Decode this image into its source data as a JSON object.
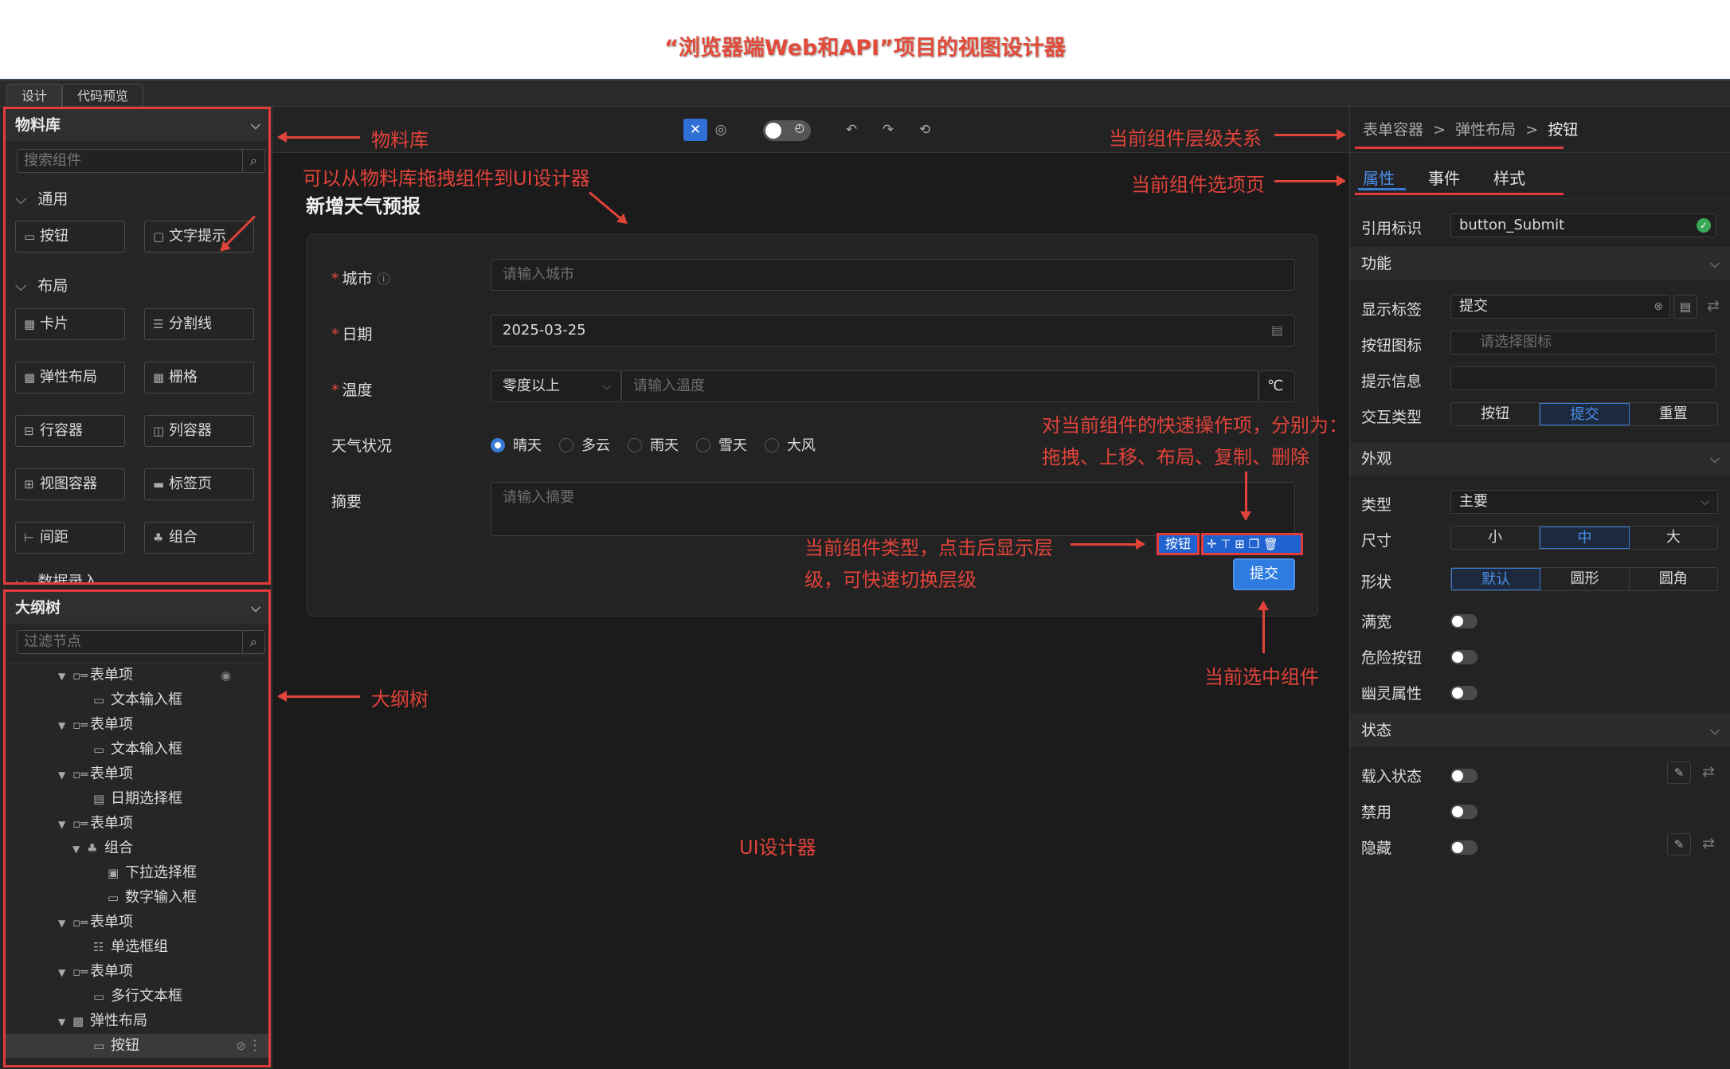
{
  "page_title": "“浏览器端Web和API”项目的视图设计器",
  "mode_tabs": [
    "设计",
    "代码预览"
  ],
  "material": {
    "title": "物料库",
    "search_placeholder": "搜索组件",
    "group_common": "通用",
    "group_layout": "布局",
    "group_input": "数据录入",
    "components": {
      "button": "按钮",
      "tooltip": "文字提示",
      "card": "卡片",
      "divider": "分割线",
      "flex": "弹性布局",
      "grid": "栅格",
      "row": "行容器",
      "col": "列容器",
      "view": "视图容器",
      "tabs": "标签页",
      "space": "间距",
      "combo": "组合"
    }
  },
  "outline": {
    "title": "大纲树",
    "search_placeholder": "过滤节点",
    "nodes": [
      {
        "label": "表单项"
      },
      {
        "label": "文本输入框"
      },
      {
        "label": "表单项"
      },
      {
        "label": "文本输入框"
      },
      {
        "label": "表单项"
      },
      {
        "label": "日期选择框"
      },
      {
        "label": "表单项"
      },
      {
        "label": "组合"
      },
      {
        "label": "下拉选择框"
      },
      {
        "label": "数字输入框"
      },
      {
        "label": "表单项"
      },
      {
        "label": "单选框组"
      },
      {
        "label": "表单项"
      },
      {
        "label": "多行文本框"
      },
      {
        "label": "弹性布局"
      },
      {
        "label": "按钮"
      }
    ]
  },
  "form": {
    "title": "新增天气预报",
    "city_label": "城市",
    "city_placeholder": "请输入城市",
    "date_label": "日期",
    "date_value": "2025-03-25",
    "temp_label": "温度",
    "temp_select": "零度以上",
    "temp_placeholder": "请输入温度",
    "temp_unit": "℃",
    "weather_label": "天气状况",
    "weather_options": [
      "晴天",
      "多云",
      "雨天",
      "雪天",
      "大风"
    ],
    "weather_selected": "晴天",
    "summary_label": "摘要",
    "summary_placeholder": "请输入摘要",
    "submit_label": "提交",
    "type_tag": "按钮"
  },
  "props": {
    "breadcrumb": [
      "表单容器",
      ">",
      "弹性布局",
      ">",
      "按钮"
    ],
    "tabs": [
      "属性",
      "事件",
      "样式"
    ],
    "ref_label": "引用标识",
    "ref_value": "button_Submit",
    "sec_func": "功能",
    "display_label": "显示标签",
    "display_value": "提交",
    "icon_label": "按钮图标",
    "icon_placeholder": "请选择图标",
    "tip_label": "提示信息",
    "interact_label": "交互类型",
    "interact_options": [
      "按钮",
      "提交",
      "重置"
    ],
    "sec_appear": "外观",
    "type_label": "类型",
    "type_value": "主要",
    "size_label": "尺寸",
    "size_options": [
      "小",
      "中",
      "大"
    ],
    "shape_label": "形状",
    "shape_options": [
      "默认",
      "圆形",
      "圆角"
    ],
    "full_label": "满宽",
    "danger_label": "危险按钮",
    "ghost_label": "幽灵属性",
    "sec_state": "状态",
    "loading_label": "载入状态",
    "disabled_label": "禁用",
    "hidden_label": "隐藏"
  },
  "annotations": {
    "material": "物料库",
    "drag": "可以从物料库拖拽组件到UI设计器",
    "outline": "大纲树",
    "hierarchy": "当前组件层级关系",
    "options": "当前组件选项页",
    "quick_ops_1": "对当前组件的快速操作项，分别为：",
    "quick_ops_2": "拖拽、上移、布局、复制、删除",
    "type_1": "当前组件类型，点击后显示层",
    "type_2": "级，可快速切换层级",
    "selected": "当前选中组件",
    "designer": "UI设计器"
  },
  "colors": {
    "annotation": "#e0433a",
    "accent": "#3a7bd5"
  }
}
